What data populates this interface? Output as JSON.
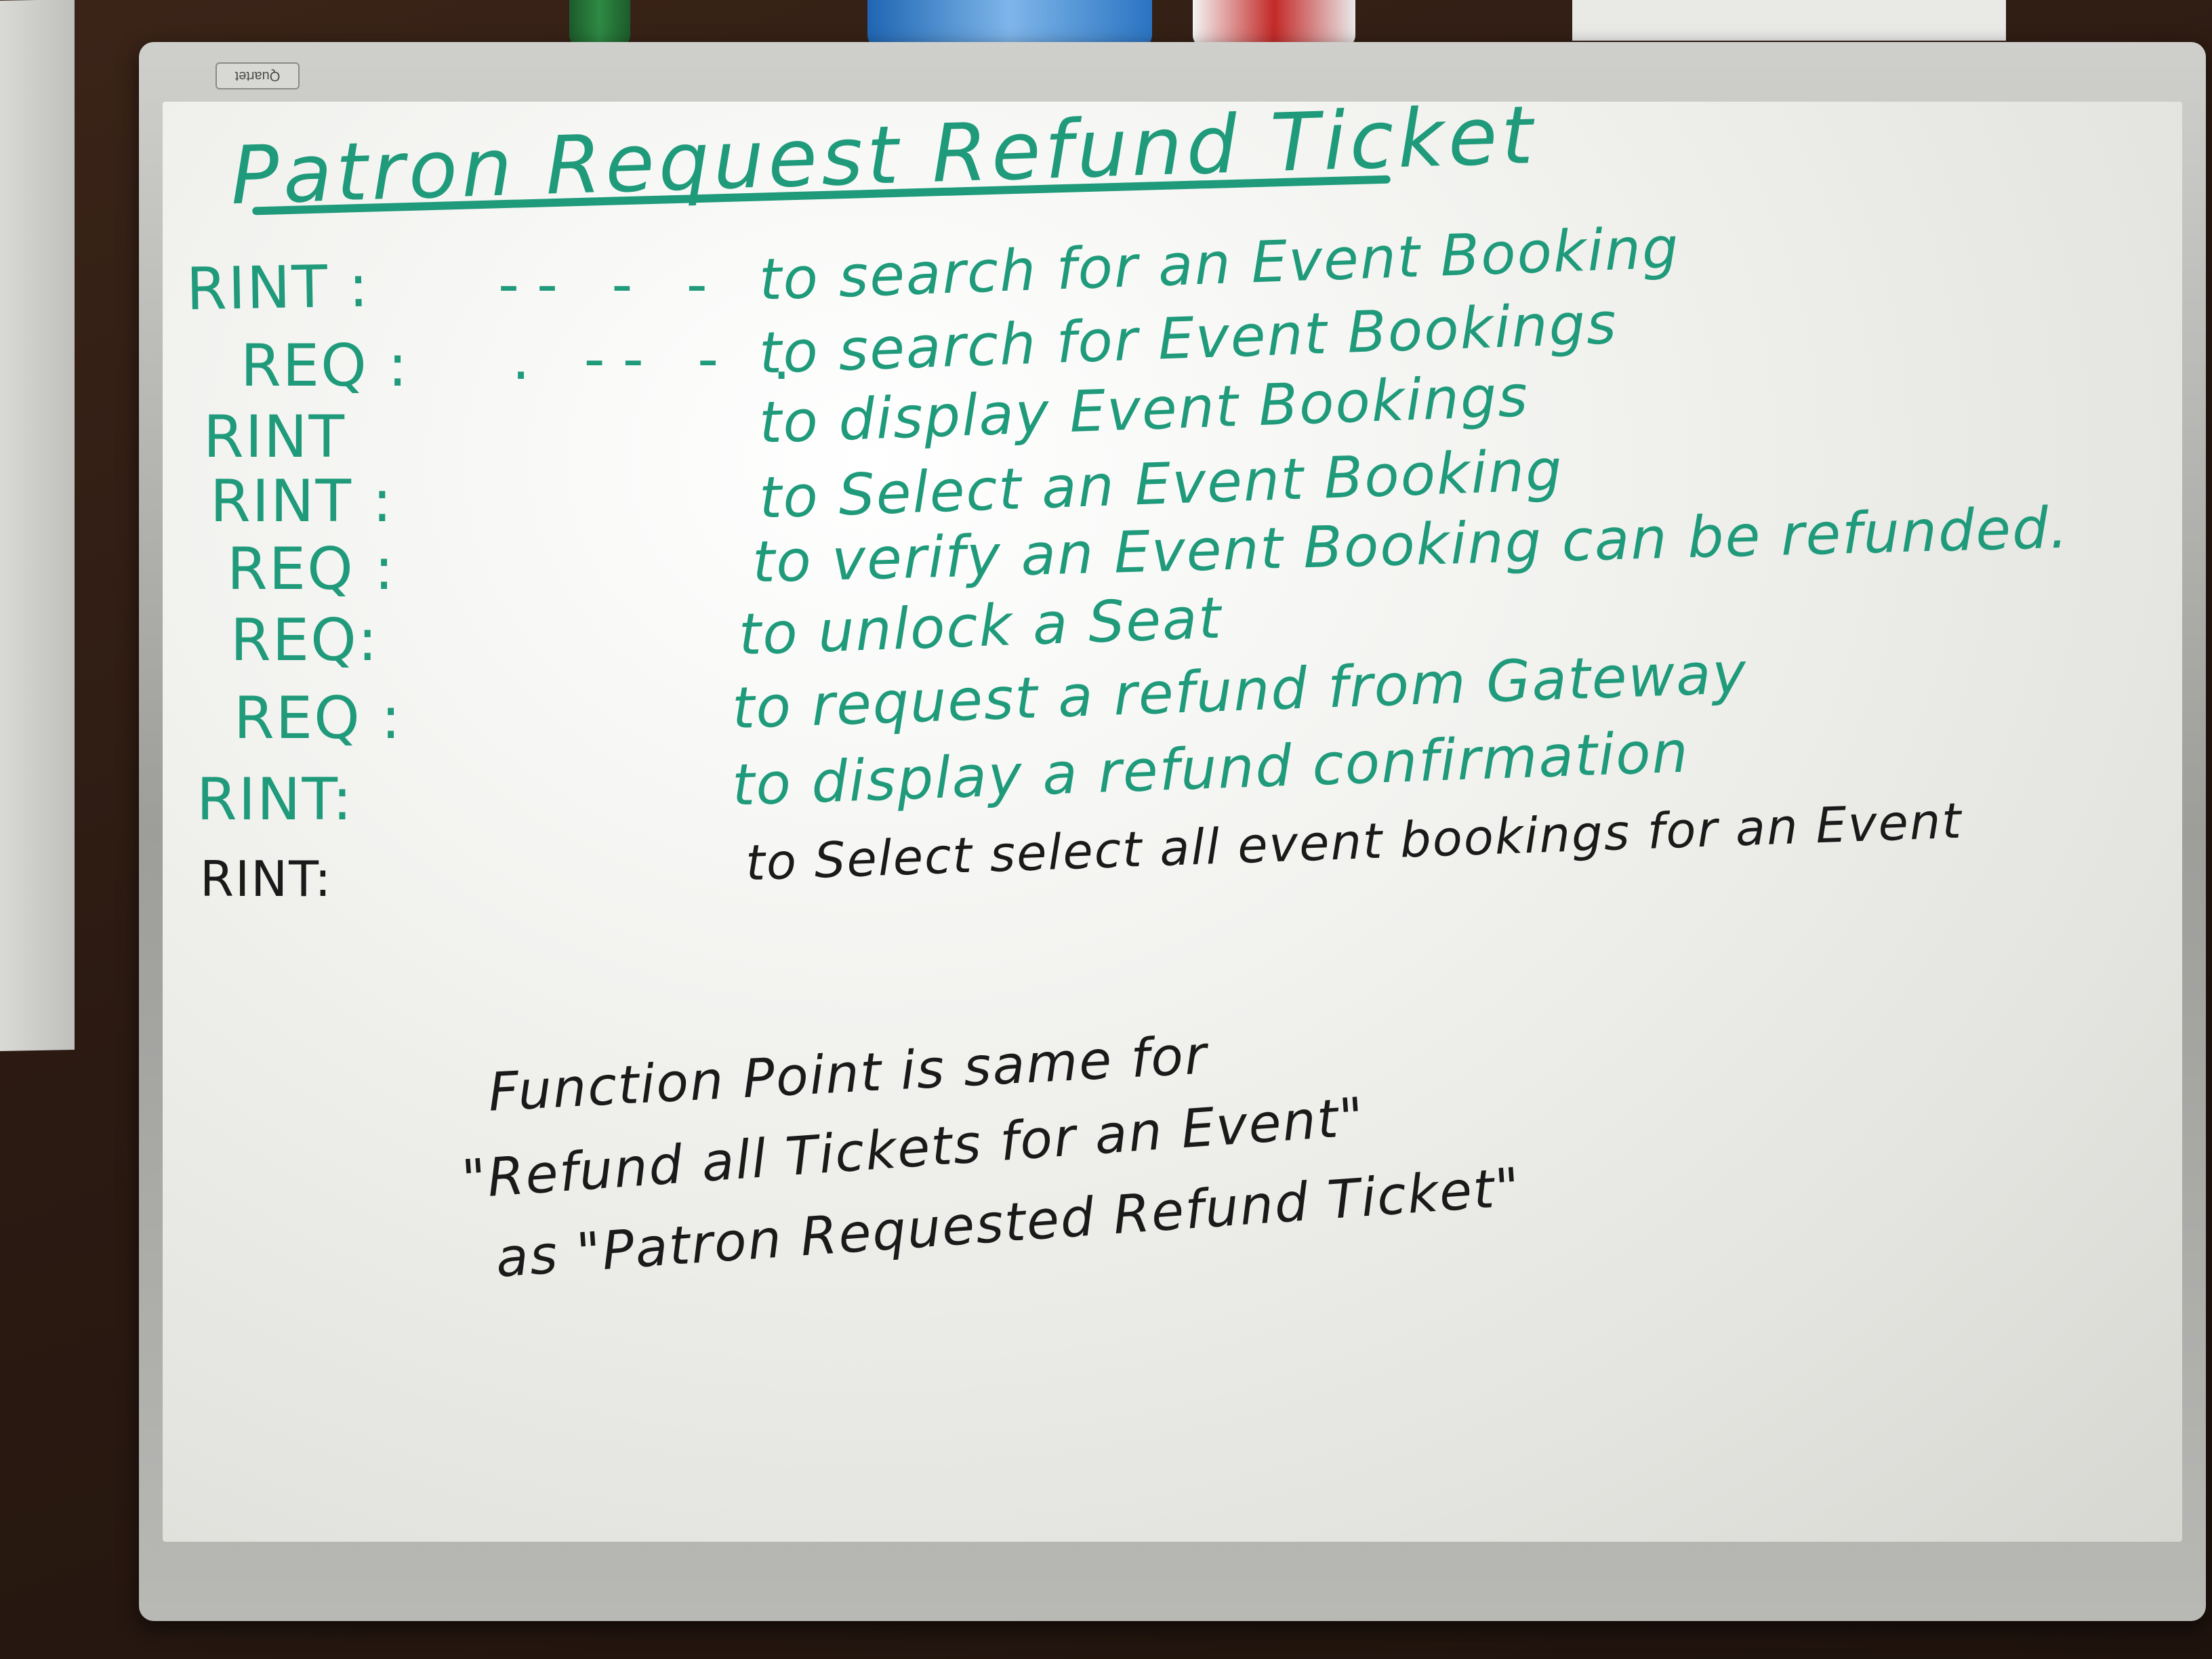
{
  "whiteboard": {
    "brand": "Quartet",
    "title": "Patron Request Refund Ticket",
    "steps": [
      {
        "label": "RINT :",
        "dashes": "-- - -",
        "text": "to search for an Event Booking",
        "color": "#1f9a7a"
      },
      {
        "label": "REQ :",
        "dashes": ". -- - .",
        "text": "to search for Event Bookings",
        "color": "#1f9a7a"
      },
      {
        "label": "RINT",
        "dashes": "",
        "text": "to display Event Bookings",
        "color": "#1f9a7a"
      },
      {
        "label": "RINT :",
        "dashes": "",
        "text": "to Select an Event Booking",
        "color": "#1f9a7a"
      },
      {
        "label": "REQ :",
        "dashes": "",
        "text": "to verify an Event Booking can be refunded.",
        "color": "#1f9a7a"
      },
      {
        "label": "REQ:",
        "dashes": "",
        "text": "to unlock a Seat",
        "color": "#1f9a7a"
      },
      {
        "label": "REQ :",
        "dashes": "",
        "text": "to request a refund from Gateway",
        "color": "#1f9a7a"
      },
      {
        "label": "RINT:",
        "dashes": "",
        "text": "to display a refund confirmation",
        "color": "#1f9a7a"
      },
      {
        "label": "RINT:",
        "dashes": "",
        "text": "to Select select all event bookings for an Event",
        "color": "#1a1a1a"
      }
    ],
    "note": {
      "line1": "Function Point is same for",
      "line2": "\"Refund all Tickets for an Event\"",
      "line3": "as   \"Patron Requested Refund Ticket\""
    },
    "colors": {
      "green_marker": "#1f9a7a",
      "black_marker": "#1a1a1a"
    }
  }
}
